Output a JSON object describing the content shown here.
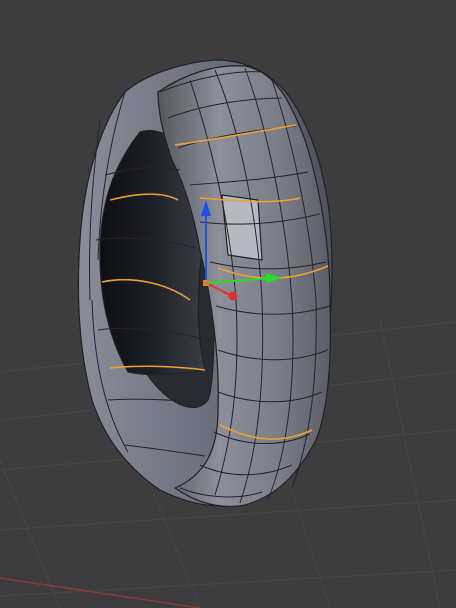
{
  "viewport": {
    "background": "#3d3d3d",
    "grid_color": "#474747",
    "x_axis_color": "#8f3a3a",
    "object": "torus",
    "mode": "edit",
    "selected_edge_loop_color": "#f0a030",
    "gizmo": {
      "x_color": "#e03030",
      "y_color": "#20e020",
      "z_color": "#2050f0",
      "origin_color": "#e08020"
    }
  }
}
